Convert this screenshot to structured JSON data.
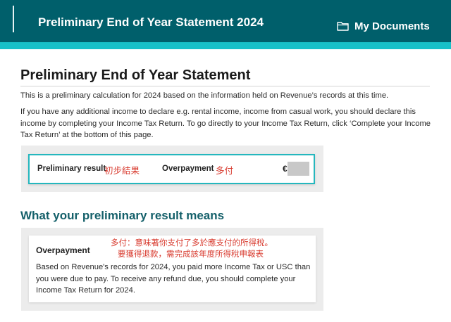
{
  "header": {
    "title": "Preliminary End of Year Statement 2024",
    "my_documents": "My Documents",
    "my_documents_icon": "folder-icon",
    "bg_color": "#005f6b",
    "strip_color": "#18c0c8"
  },
  "page": {
    "title": "Preliminary End of Year Statement",
    "intro": "This is a preliminary calculation for 2024 based on the information held on Revenue’s records at this time.",
    "instructions": "If you have any additional income to declare e.g. rental income, income from casual work, you should declare this income by completing your Income Tax Return. To go directly to your Income Tax Return, click ‘Complete your Income Tax Return’ at the bottom of this page."
  },
  "result": {
    "label": "Preliminary result",
    "label_annotation": "初步結果",
    "status": "Overpayment",
    "status_annotation": "多付",
    "currency": "€",
    "accent_color": "#25b7be"
  },
  "meaning": {
    "section_title": "What your preliminary result means",
    "heading": "Overpayment",
    "annotation_line1": "多付：意味著你支付了多於應支付的所得稅。",
    "annotation_line2": "要獲得退款，需完成該年度所得稅申報表",
    "body": "Based on Revenue's records for 2024, you paid more Income Tax or USC than you were due to pay. To receive any refund due, you should complete your Income Tax Return for 2024."
  }
}
